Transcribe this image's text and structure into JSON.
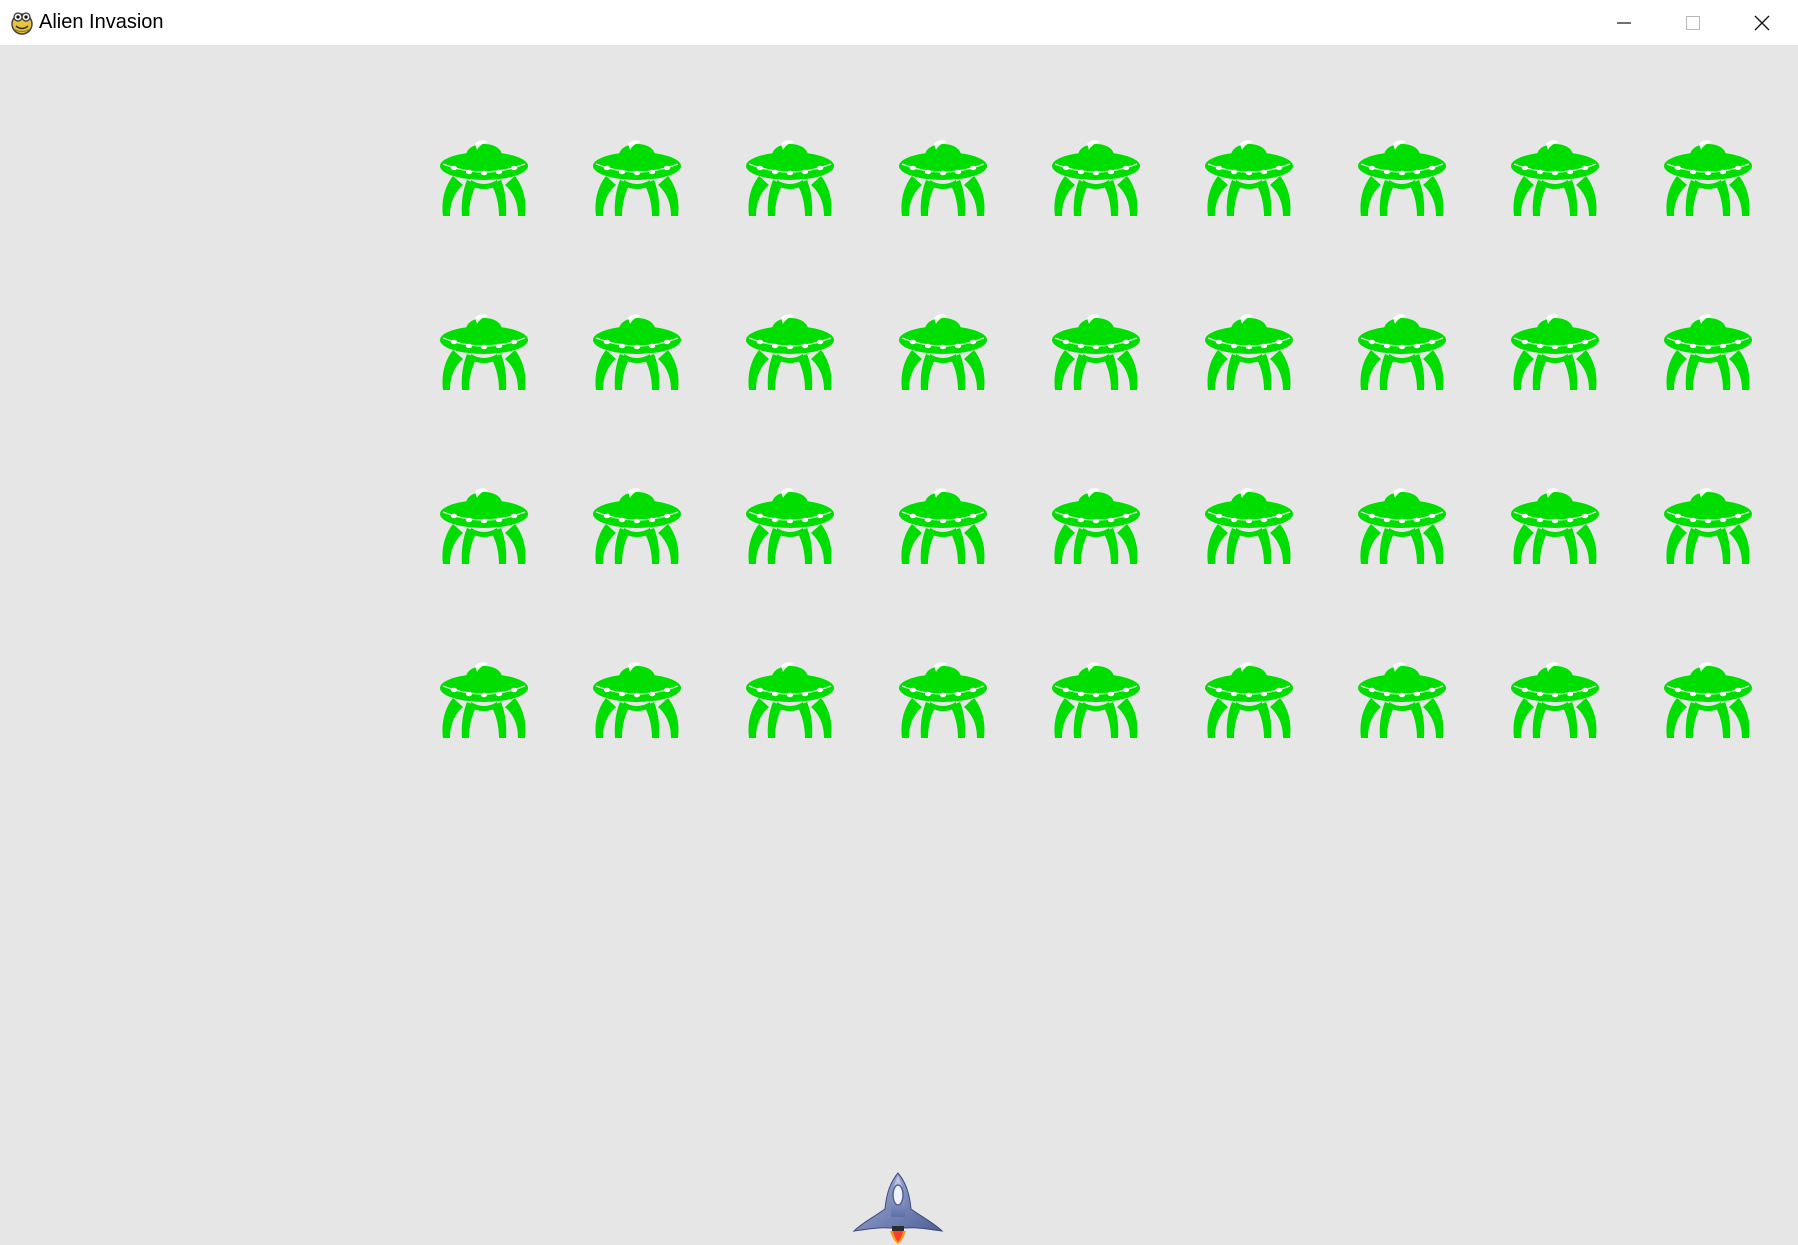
{
  "window": {
    "title": "Alien Invasion",
    "controls": [
      "minimize",
      "maximize",
      "close"
    ]
  },
  "game": {
    "background_color": "#e6e6e6",
    "alien_color": "#00dd00",
    "fleet": {
      "rows": 4,
      "columns": 9,
      "alien_count": 36
    },
    "ship": "player-ship"
  }
}
